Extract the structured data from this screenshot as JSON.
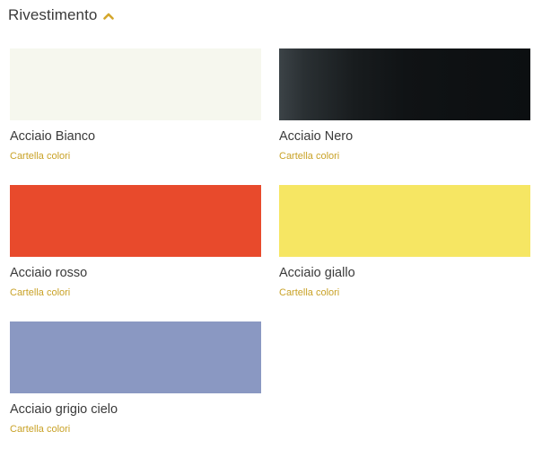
{
  "section": {
    "title": "Rivestimento",
    "toggle_icon": "chevron-up-icon",
    "accent_color": "#d4a72c"
  },
  "swatches": [
    {
      "name": "Acciaio Bianco",
      "link_label": "Cartella colori",
      "color": "#f6f7ee",
      "slug": "bianco"
    },
    {
      "name": "Acciaio Nero",
      "link_label": "Cartella colori",
      "color": "#1c2023",
      "slug": "nero"
    },
    {
      "name": "Acciaio rosso",
      "link_label": "Cartella colori",
      "color": "#e84a2c",
      "slug": "rosso"
    },
    {
      "name": "Acciaio giallo",
      "link_label": "Cartella colori",
      "color": "#f6e663",
      "slug": "giallo"
    },
    {
      "name": "Acciaio grigio cielo",
      "link_label": "Cartella colori",
      "color": "#8a98c2",
      "slug": "grigio-cielo"
    }
  ]
}
